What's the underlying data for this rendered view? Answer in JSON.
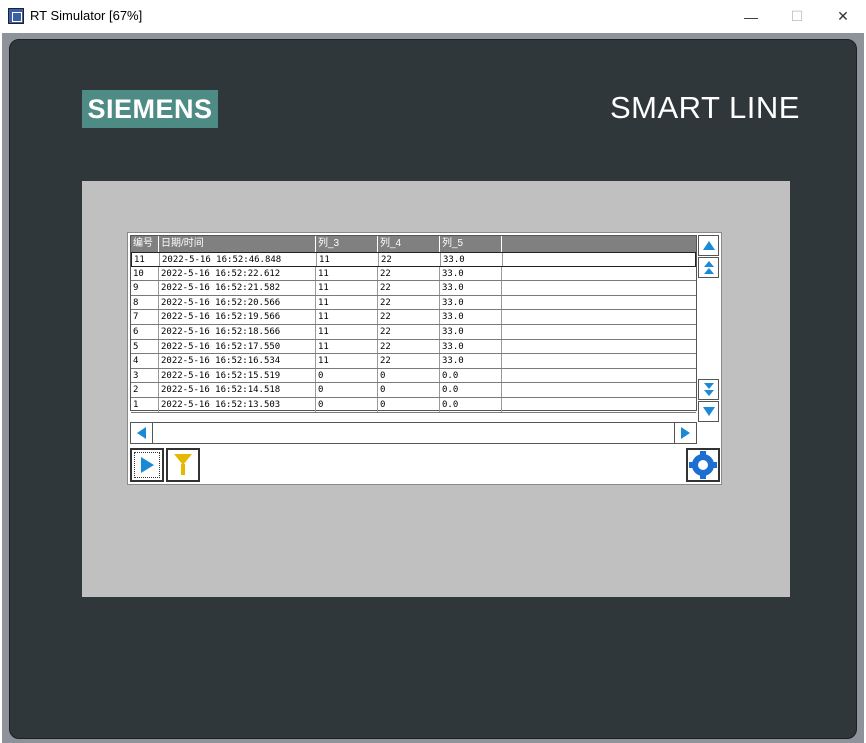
{
  "window": {
    "title": "RT Simulator [67%]",
    "minimize_glyph": "—",
    "maximize_glyph": "☐",
    "close_glyph": "✕"
  },
  "device": {
    "brand": "SIEMENS",
    "product_line": "SMART LINE",
    "brand_color": "#4f8b85",
    "bezel_color": "#30373a",
    "screen_color": "#c0c0c0"
  },
  "table": {
    "columns": [
      "编号",
      "日期/时间",
      "列_3",
      "列_4",
      "列_5",
      ""
    ],
    "rows": [
      [
        "11",
        "2022-5-16 16:52:46.848",
        "11",
        "22",
        "33.0"
      ],
      [
        "10",
        "2022-5-16 16:52:22.612",
        "11",
        "22",
        "33.0"
      ],
      [
        "9",
        "2022-5-16 16:52:21.582",
        "11",
        "22",
        "33.0"
      ],
      [
        "8",
        "2022-5-16 16:52:20.566",
        "11",
        "22",
        "33.0"
      ],
      [
        "7",
        "2022-5-16 16:52:19.566",
        "11",
        "22",
        "33.0"
      ],
      [
        "6",
        "2022-5-16 16:52:18.566",
        "11",
        "22",
        "33.0"
      ],
      [
        "5",
        "2022-5-16 16:52:17.550",
        "11",
        "22",
        "33.0"
      ],
      [
        "4",
        "2022-5-16 16:52:16.534",
        "11",
        "22",
        "33.0"
      ],
      [
        "3",
        "2022-5-16 16:52:15.519",
        "0",
        "0",
        "0.0"
      ],
      [
        "2",
        "2022-5-16 16:52:14.518",
        "0",
        "0",
        "0.0"
      ],
      [
        "1",
        "2022-5-16 16:52:13.503",
        "0",
        "0",
        "0.0"
      ]
    ],
    "selected_row": 0,
    "header_color": "#808080"
  },
  "icons": {
    "scroll_up": "arrow-up-icon",
    "page_up": "double-arrow-up-icon",
    "page_down": "double-arrow-down-icon",
    "scroll_down": "arrow-down-icon",
    "scroll_left": "arrow-left-icon",
    "scroll_right": "arrow-right-icon",
    "play": "play-icon",
    "filter": "filter-icon",
    "settings": "gear-icon",
    "accent_color": "#1b8ad6"
  }
}
